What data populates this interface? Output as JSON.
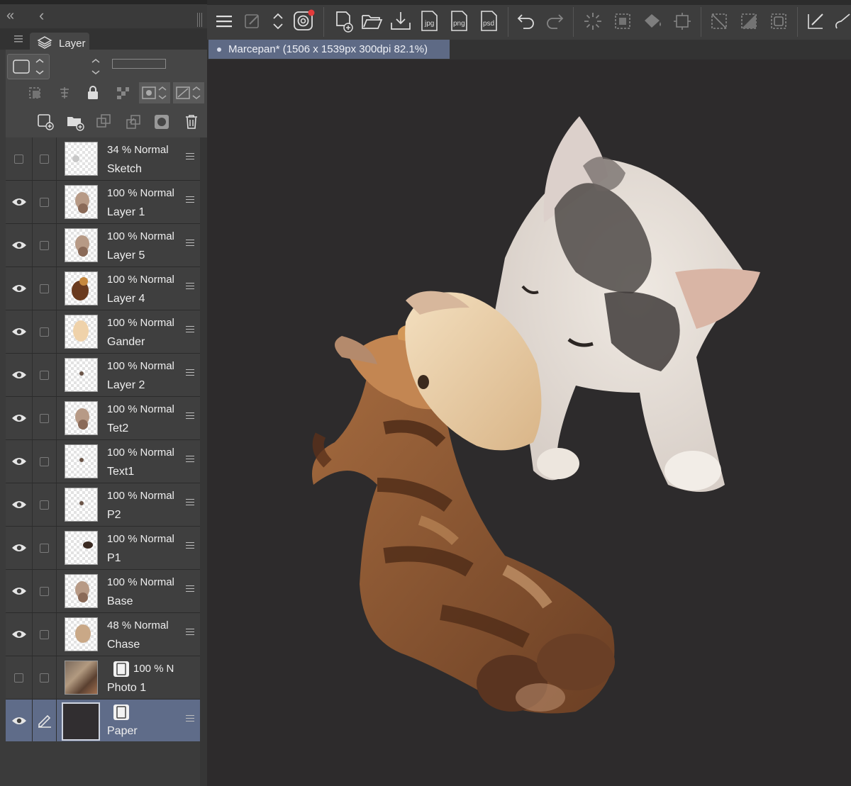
{
  "panel": {
    "collapse_left": "«",
    "collapse_back": "‹",
    "tab_label": "Layer"
  },
  "document": {
    "tab_title": "Marcepan* (1506 x 1539px 300dpi 82.1%)"
  },
  "layers": [
    {
      "opacity": "34 %",
      "blend": "Normal",
      "name": "Sketch",
      "visible": false,
      "selected": false
    },
    {
      "opacity": "100 %",
      "blend": "Normal",
      "name": "Layer 1",
      "visible": true,
      "selected": false
    },
    {
      "opacity": "100 %",
      "blend": "Normal",
      "name": "Layer 5",
      "visible": true,
      "selected": false
    },
    {
      "opacity": "100 %",
      "blend": "Normal",
      "name": "Layer 4",
      "visible": true,
      "selected": false
    },
    {
      "opacity": "100 %",
      "blend": "Normal",
      "name": "Gander",
      "visible": true,
      "selected": false
    },
    {
      "opacity": "100 %",
      "blend": "Normal",
      "name": "Layer 2",
      "visible": true,
      "selected": false
    },
    {
      "opacity": "100 %",
      "blend": "Normal",
      "name": "Tet2",
      "visible": true,
      "selected": false
    },
    {
      "opacity": "100 %",
      "blend": "Normal",
      "name": "Text1",
      "visible": true,
      "selected": false
    },
    {
      "opacity": "100 %",
      "blend": "Normal",
      "name": "P2",
      "visible": true,
      "selected": false
    },
    {
      "opacity": "100 %",
      "blend": "Normal",
      "name": "P1",
      "visible": true,
      "selected": false
    },
    {
      "opacity": "100 %",
      "blend": "Normal",
      "name": "Base",
      "visible": true,
      "selected": false
    },
    {
      "opacity": "48 %",
      "blend": "Normal",
      "name": "Chase",
      "visible": true,
      "selected": false
    },
    {
      "opacity": "100 %",
      "blend": "N",
      "name": "Photo 1",
      "visible": false,
      "selected": false
    },
    {
      "opacity": "",
      "blend": "",
      "name": "Paper",
      "visible": true,
      "selected": true
    }
  ],
  "toolbar": {
    "export_jpg": "jpg",
    "export_png": "png",
    "export_psd": "psd"
  },
  "colors": {
    "selection": "#5f6c89",
    "canvas": "#2d2b2c",
    "paper": "#312e30",
    "record_dot": "#e33b3b"
  },
  "icons": [
    "menu-icon",
    "gear-pen-icon",
    "updown-icon",
    "record-icon",
    "new-canvas-icon",
    "open-icon",
    "save-icon",
    "undo-icon",
    "redo-icon",
    "select-all-icon",
    "fill-icon",
    "crop-icon",
    "deselect-icon",
    "pen-icon"
  ]
}
